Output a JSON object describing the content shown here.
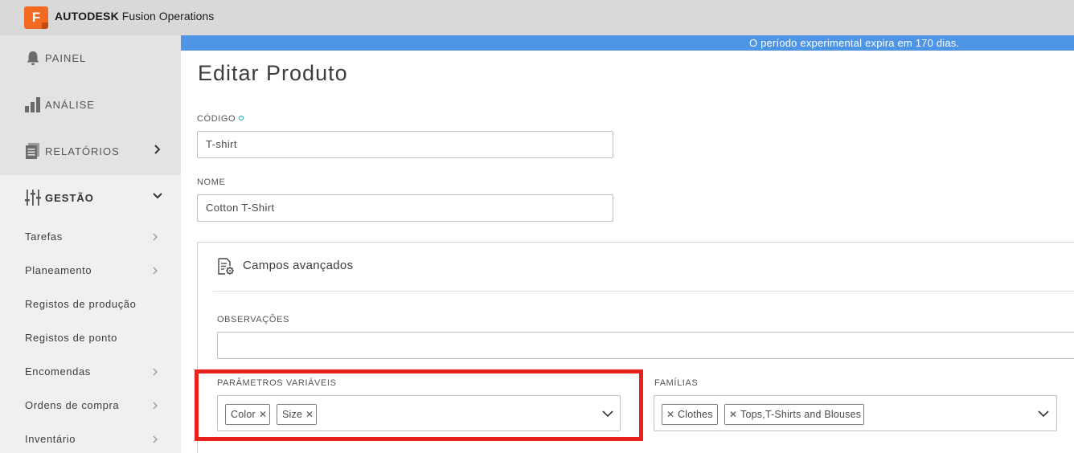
{
  "app": {
    "logo_letter": "F",
    "brand": "AUTODESK",
    "product": "Fusion Operations",
    "accent": "#f26a22"
  },
  "banner": {
    "text": "O período experimental expira em 170 dias.",
    "color": "#4f95e6"
  },
  "sidebar": {
    "main": [
      {
        "label": "PAINEL",
        "icon": "bell-icon"
      },
      {
        "label": "ANÁLISE",
        "icon": "bar-chart-icon"
      },
      {
        "label": "RELATÓRIOS",
        "icon": "report-icon"
      },
      {
        "label": "GESTÃO",
        "icon": "sliders-icon"
      }
    ],
    "sub": [
      {
        "label": "Tarefas"
      },
      {
        "label": "Planeamento"
      },
      {
        "label": "Registos de produção"
      },
      {
        "label": "Registos de ponto"
      },
      {
        "label": "Encomendas"
      },
      {
        "label": "Ordens de compra"
      },
      {
        "label": "Inventário"
      }
    ]
  },
  "page": {
    "title": "Editar Produto"
  },
  "form": {
    "code": {
      "label": "CÓDIGO",
      "value": "T-shirt"
    },
    "name": {
      "label": "NOME",
      "value": "Cotton T-Shirt"
    },
    "advanced": {
      "title": "Campos avançados",
      "notes_label": "OBSERVAÇÕES",
      "notes_value": "",
      "variable_params": {
        "label": "PARÂMETROS VARIÁVEIS",
        "chips": [
          "Color",
          "Size"
        ]
      },
      "families": {
        "label": "FAMÍLIAS",
        "chips": [
          "Clothes",
          "Tops,T-Shirts and Blouses"
        ]
      }
    }
  },
  "highlight_color": "#e8211c"
}
